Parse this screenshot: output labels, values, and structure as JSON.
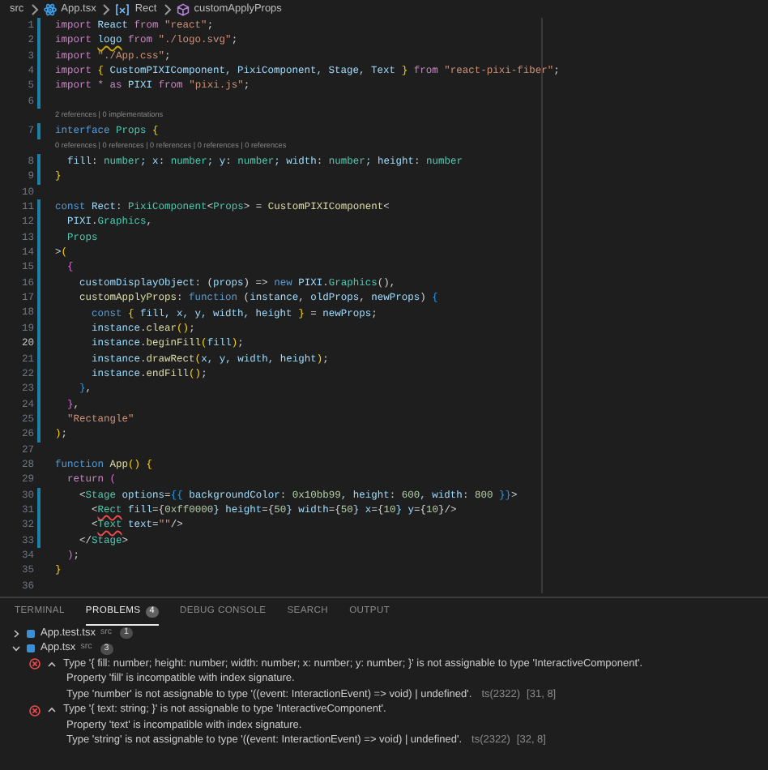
{
  "breadcrumb": [
    {
      "label": "src",
      "kind": "folder"
    },
    {
      "label": "App.tsx",
      "kind": "file"
    },
    {
      "label": "Rect",
      "kind": "variable"
    },
    {
      "label": "customApplyProps",
      "kind": "method"
    }
  ],
  "editor": {
    "lines": [
      {
        "kind": "code",
        "number": "1",
        "changed": true,
        "current": false,
        "tokens": [
          {
            "text": "import ",
            "kind": "k"
          },
          {
            "text": "React ",
            "kind": "v"
          },
          {
            "text": "from ",
            "kind": "k"
          },
          {
            "text": "\"react\"",
            "kind": "str"
          },
          {
            "text": ";",
            "kind": "p"
          }
        ]
      },
      {
        "kind": "code",
        "number": "2",
        "changed": true,
        "current": false,
        "tokens": [
          {
            "text": "import ",
            "kind": "k"
          },
          {
            "text": "logo",
            "kind": "warn"
          },
          {
            "text": " from ",
            "kind": "k"
          },
          {
            "text": "\"./logo.svg\"",
            "kind": "str"
          },
          {
            "text": ";",
            "kind": "p"
          }
        ]
      },
      {
        "kind": "code",
        "number": "3",
        "changed": true,
        "current": false,
        "tokens": [
          {
            "text": "import ",
            "kind": "k"
          },
          {
            "text": "\"./App.css\"",
            "kind": "str"
          },
          {
            "text": ";",
            "kind": "p"
          }
        ]
      },
      {
        "kind": "code",
        "number": "4",
        "changed": true,
        "current": false,
        "tokens": [
          {
            "text": "import ",
            "kind": "k"
          },
          {
            "text": "{",
            "kind": "b"
          },
          {
            "text": " CustomPIXIComponent, PixiComponent, Stage, Text ",
            "kind": "v"
          },
          {
            "text": "}",
            "kind": "b"
          },
          {
            "text": " from ",
            "kind": "k"
          },
          {
            "text": "\"react-pixi-fiber\"",
            "kind": "str"
          },
          {
            "text": ";",
            "kind": "p"
          }
        ]
      },
      {
        "kind": "code",
        "number": "5",
        "changed": true,
        "current": false,
        "tokens": [
          {
            "text": "import * ",
            "kind": "k"
          },
          {
            "text": "as",
            "kind": "k"
          },
          {
            "text": " PIXI ",
            "kind": "v"
          },
          {
            "text": "from ",
            "kind": "k"
          },
          {
            "text": "\"pixi.js\"",
            "kind": "str"
          },
          {
            "text": ";",
            "kind": "p"
          }
        ]
      },
      {
        "kind": "code",
        "number": "6",
        "changed": true,
        "current": false
      },
      {
        "kind": "lens",
        "text": "2 references | 0 implementations"
      },
      {
        "kind": "code",
        "number": "7",
        "changed": true,
        "current": false,
        "tokens": [
          {
            "text": "interface ",
            "kind": "s"
          },
          {
            "text": "Props ",
            "kind": "ty"
          },
          {
            "text": "{",
            "kind": "b"
          }
        ]
      },
      {
        "kind": "lens",
        "text": "0 references | 0 references | 0 references | 0 references | 0 references"
      },
      {
        "kind": "code",
        "number": "8",
        "changed": true,
        "current": false,
        "tokens": [
          {
            "text": "  fill",
            "kind": "v"
          },
          {
            "text": ": ",
            "kind": "p"
          },
          {
            "text": "number",
            "kind": "ty"
          },
          {
            "text": "; x",
            "kind": "v"
          },
          {
            "text": ": ",
            "kind": "p"
          },
          {
            "text": "number",
            "kind": "ty"
          },
          {
            "text": "; y",
            "kind": "v"
          },
          {
            "text": ": ",
            "kind": "p"
          },
          {
            "text": "number",
            "kind": "ty"
          },
          {
            "text": "; width",
            "kind": "v"
          },
          {
            "text": ": ",
            "kind": "p"
          },
          {
            "text": "number",
            "kind": "ty"
          },
          {
            "text": "; height",
            "kind": "v"
          },
          {
            "text": ": ",
            "kind": "p"
          },
          {
            "text": "number",
            "kind": "ty"
          }
        ]
      },
      {
        "kind": "code",
        "number": "9",
        "changed": true,
        "current": false,
        "tokens": [
          {
            "text": "}",
            "kind": "b"
          }
        ]
      },
      {
        "kind": "code",
        "number": "10",
        "changed": false,
        "current": false
      },
      {
        "kind": "code",
        "number": "11",
        "changed": true,
        "current": false,
        "tokens": [
          {
            "text": "const ",
            "kind": "s"
          },
          {
            "text": "Rect",
            "kind": "v"
          },
          {
            "text": ": ",
            "kind": "p"
          },
          {
            "text": "PixiComponent",
            "kind": "ty"
          },
          {
            "text": "<",
            "kind": "p"
          },
          {
            "text": "Props",
            "kind": "ty"
          },
          {
            "text": "> = ",
            "kind": "p"
          },
          {
            "text": "CustomPIXIComponent",
            "kind": "fn"
          },
          {
            "text": "<",
            "kind": "p"
          }
        ]
      },
      {
        "kind": "code",
        "number": "12",
        "changed": true,
        "current": false,
        "tokens": [
          {
            "text": "  PIXI",
            "kind": "v"
          },
          {
            "text": ".",
            "kind": "p"
          },
          {
            "text": "Graphics",
            "kind": "ty"
          },
          {
            "text": ",",
            "kind": "p"
          }
        ]
      },
      {
        "kind": "code",
        "number": "13",
        "changed": true,
        "current": false,
        "tokens": [
          {
            "text": "  Props",
            "kind": "ty"
          }
        ]
      },
      {
        "kind": "code",
        "number": "14",
        "changed": true,
        "current": false,
        "tokens": [
          {
            "text": ">",
            "kind": "p"
          },
          {
            "text": "(",
            "kind": "b"
          }
        ]
      },
      {
        "kind": "code",
        "number": "15",
        "changed": true,
        "current": false,
        "tokens": [
          {
            "text": "  {",
            "kind": "b2"
          }
        ]
      },
      {
        "kind": "code",
        "number": "16",
        "changed": true,
        "current": false,
        "tokens": [
          {
            "text": "    customDisplayObject",
            "kind": "v"
          },
          {
            "text": ": (",
            "kind": "p"
          },
          {
            "text": "props",
            "kind": "v"
          },
          {
            "text": ") => ",
            "kind": "p"
          },
          {
            "text": "new",
            "kind": "s"
          },
          {
            "text": " PIXI",
            "kind": "v"
          },
          {
            "text": ".",
            "kind": "p"
          },
          {
            "text": "Graphics",
            "kind": "ty"
          },
          {
            "text": "(),",
            "kind": "p"
          }
        ]
      },
      {
        "kind": "code",
        "number": "17",
        "changed": true,
        "current": false,
        "tokens": [
          {
            "text": "    customApplyProps",
            "kind": "fn"
          },
          {
            "text": ": ",
            "kind": "p"
          },
          {
            "text": "function",
            "kind": "s"
          },
          {
            "text": " (",
            "kind": "p"
          },
          {
            "text": "instance",
            "kind": "v"
          },
          {
            "text": ", ",
            "kind": "p"
          },
          {
            "text": "oldProps",
            "kind": "v"
          },
          {
            "text": ", ",
            "kind": "p"
          },
          {
            "text": "newProps",
            "kind": "v"
          },
          {
            "text": ") ",
            "kind": "p"
          },
          {
            "text": "{",
            "kind": "b3"
          }
        ]
      },
      {
        "kind": "code",
        "number": "18",
        "changed": true,
        "current": false,
        "tokens": [
          {
            "text": "      const ",
            "kind": "s"
          },
          {
            "text": "{",
            "kind": "b"
          },
          {
            "text": " fill, x, y, width, height ",
            "kind": "v"
          },
          {
            "text": "}",
            "kind": "b"
          },
          {
            "text": " = ",
            "kind": "p"
          },
          {
            "text": "newProps",
            "kind": "v"
          },
          {
            "text": ";",
            "kind": "p"
          }
        ]
      },
      {
        "kind": "code",
        "number": "19",
        "changed": true,
        "current": false,
        "tokens": [
          {
            "text": "      instance",
            "kind": "v"
          },
          {
            "text": ".",
            "kind": "p"
          },
          {
            "text": "clear",
            "kind": "fn"
          },
          {
            "text": "()",
            "kind": "b"
          },
          {
            "text": ";",
            "kind": "p"
          }
        ]
      },
      {
        "kind": "code",
        "number": "20",
        "changed": true,
        "current": true,
        "tokens": [
          {
            "text": "      instance",
            "kind": "v"
          },
          {
            "text": ".",
            "kind": "p"
          },
          {
            "text": "beginFill",
            "kind": "fn"
          },
          {
            "text": "(",
            "kind": "b"
          },
          {
            "text": "fill",
            "kind": "v"
          },
          {
            "text": ")",
            "kind": "b"
          },
          {
            "text": ";",
            "kind": "p"
          }
        ]
      },
      {
        "kind": "code",
        "number": "21",
        "changed": true,
        "current": false,
        "tokens": [
          {
            "text": "      instance",
            "kind": "v"
          },
          {
            "text": ".",
            "kind": "p"
          },
          {
            "text": "drawRect",
            "kind": "fn"
          },
          {
            "text": "(",
            "kind": "b"
          },
          {
            "text": "x, y, width, height",
            "kind": "v"
          },
          {
            "text": ")",
            "kind": "b"
          },
          {
            "text": ";",
            "kind": "p"
          }
        ]
      },
      {
        "kind": "code",
        "number": "22",
        "changed": true,
        "current": false,
        "tokens": [
          {
            "text": "      instance",
            "kind": "v"
          },
          {
            "text": ".",
            "kind": "p"
          },
          {
            "text": "endFill",
            "kind": "fn"
          },
          {
            "text": "()",
            "kind": "b"
          },
          {
            "text": ";",
            "kind": "p"
          }
        ]
      },
      {
        "kind": "code",
        "number": "23",
        "changed": true,
        "current": false,
        "tokens": [
          {
            "text": "    }",
            "kind": "b3"
          },
          {
            "text": ",",
            "kind": "p"
          }
        ]
      },
      {
        "kind": "code",
        "number": "24",
        "changed": true,
        "current": false,
        "tokens": [
          {
            "text": "  }",
            "kind": "b2"
          },
          {
            "text": ",",
            "kind": "p"
          }
        ]
      },
      {
        "kind": "code",
        "number": "25",
        "changed": true,
        "current": false,
        "tokens": [
          {
            "text": "  \"Rectangle\"",
            "kind": "str"
          }
        ]
      },
      {
        "kind": "code",
        "number": "26",
        "changed": true,
        "current": false,
        "tokens": [
          {
            "text": ")",
            "kind": "b"
          },
          {
            "text": ";",
            "kind": "p"
          }
        ]
      },
      {
        "kind": "code",
        "number": "27",
        "changed": false,
        "current": false
      },
      {
        "kind": "code",
        "number": "28",
        "changed": false,
        "current": false,
        "tokens": [
          {
            "text": "function ",
            "kind": "s"
          },
          {
            "text": "App",
            "kind": "fn"
          },
          {
            "text": "() {",
            "kind": "b"
          }
        ]
      },
      {
        "kind": "code",
        "number": "29",
        "changed": false,
        "current": false,
        "tokens": [
          {
            "text": "  return ",
            "kind": "k"
          },
          {
            "text": "(",
            "kind": "b2"
          }
        ]
      },
      {
        "kind": "code",
        "number": "30",
        "changed": true,
        "current": false,
        "tokens": [
          {
            "text": "    <",
            "kind": "p"
          },
          {
            "text": "Stage",
            "kind": "ty"
          },
          {
            "text": " options",
            "kind": "v"
          },
          {
            "text": "=",
            "kind": "p"
          },
          {
            "text": "{{",
            "kind": "b3"
          },
          {
            "text": " backgroundColor",
            "kind": "v"
          },
          {
            "text": ": ",
            "kind": "p"
          },
          {
            "text": "0x10bb99",
            "kind": "n"
          },
          {
            "text": ", height",
            "kind": "v"
          },
          {
            "text": ": ",
            "kind": "p"
          },
          {
            "text": "600",
            "kind": "n"
          },
          {
            "text": ", width",
            "kind": "v"
          },
          {
            "text": ": ",
            "kind": "p"
          },
          {
            "text": "800",
            "kind": "n"
          },
          {
            "text": " }}",
            "kind": "b3"
          },
          {
            "text": ">",
            "kind": "p"
          }
        ]
      },
      {
        "kind": "code",
        "number": "31",
        "changed": true,
        "current": false,
        "tokens": [
          {
            "text": "      <",
            "kind": "p"
          },
          {
            "text": "Rect",
            "kind": "err"
          },
          {
            "text": " fill",
            "kind": "v"
          },
          {
            "text": "={",
            "kind": "p"
          },
          {
            "text": "0xff0000",
            "kind": "n"
          },
          {
            "text": "} height",
            "kind": "v"
          },
          {
            "text": "={",
            "kind": "p"
          },
          {
            "text": "50",
            "kind": "n"
          },
          {
            "text": "} width",
            "kind": "v"
          },
          {
            "text": "={",
            "kind": "p"
          },
          {
            "text": "50",
            "kind": "n"
          },
          {
            "text": "} x",
            "kind": "v"
          },
          {
            "text": "={",
            "kind": "p"
          },
          {
            "text": "10",
            "kind": "n"
          },
          {
            "text": "} y",
            "kind": "v"
          },
          {
            "text": "={",
            "kind": "p"
          },
          {
            "text": "10",
            "kind": "n"
          },
          {
            "text": "}/>",
            "kind": "p"
          }
        ]
      },
      {
        "kind": "code",
        "number": "32",
        "changed": true,
        "current": false,
        "tokens": [
          {
            "text": "      <",
            "kind": "p"
          },
          {
            "text": "Text",
            "kind": "err"
          },
          {
            "text": " text",
            "kind": "v"
          },
          {
            "text": "=",
            "kind": "p"
          },
          {
            "text": "\"\"",
            "kind": "str"
          },
          {
            "text": "/>",
            "kind": "p"
          }
        ]
      },
      {
        "kind": "code",
        "number": "33",
        "changed": true,
        "current": false,
        "tokens": [
          {
            "text": "    </",
            "kind": "p"
          },
          {
            "text": "Stage",
            "kind": "ty"
          },
          {
            "text": ">",
            "kind": "p"
          }
        ]
      },
      {
        "kind": "code",
        "number": "34",
        "changed": false,
        "current": false,
        "tokens": [
          {
            "text": "  )",
            "kind": "b2"
          },
          {
            "text": ";",
            "kind": "p"
          }
        ]
      },
      {
        "kind": "code",
        "number": "35",
        "changed": false,
        "current": false,
        "tokens": [
          {
            "text": "}",
            "kind": "b"
          }
        ]
      },
      {
        "kind": "code",
        "number": "36",
        "changed": false,
        "current": false
      }
    ]
  },
  "panel": {
    "tabs": [
      {
        "label": "TERMINAL",
        "selected": false
      },
      {
        "label": "PROBLEMS",
        "selected": true,
        "badge": "4"
      },
      {
        "label": "DEBUG CONSOLE",
        "selected": false
      },
      {
        "label": "SEARCH",
        "selected": false
      },
      {
        "label": "OUTPUT",
        "selected": false
      }
    ],
    "files": [
      {
        "name": "App.test.tsx",
        "path": "src",
        "count": "1",
        "expanded": false
      },
      {
        "name": "App.tsx",
        "path": "src",
        "count": "3",
        "expanded": true,
        "problems": [
          {
            "kind": "error",
            "expanded": true,
            "lines": [
              "Type '{ fill: number; height: number; width: number; x: number; y: number; }' is not assignable to type 'InteractiveComponent'.",
              "Property 'fill' is incompatible with index signature.",
              "Type 'number' is not assignable to type '((event: InteractionEvent) => void) | undefined'."
            ],
            "source": "ts(2322)",
            "position": "[31, 8]"
          },
          {
            "kind": "error",
            "expanded": true,
            "lines": [
              "Type '{ text: string; }' is not assignable to type 'InteractiveComponent'.",
              "Property 'text' is incompatible with index signature.",
              "Type 'string' is not assignable to type '((event: InteractionEvent) => void) | undefined'."
            ],
            "source": "ts(2322)",
            "position": "[32, 8]"
          }
        ]
      }
    ]
  }
}
